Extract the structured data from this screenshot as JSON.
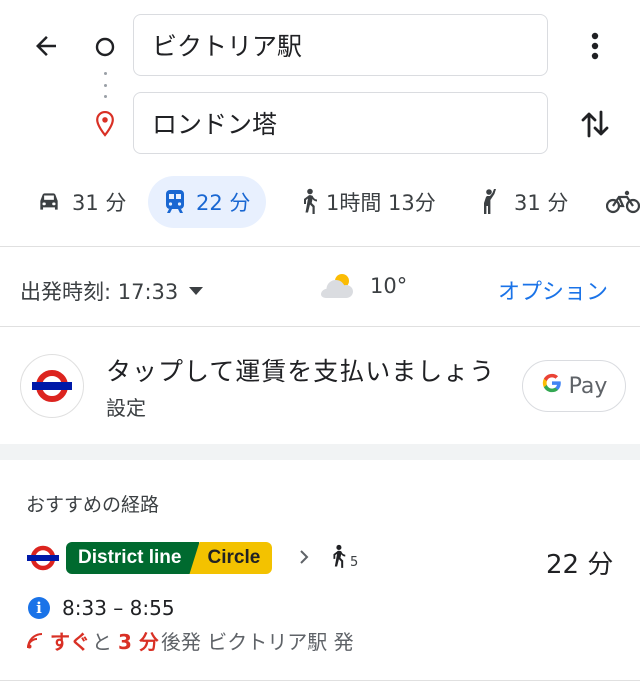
{
  "search": {
    "origin": "ビクトリア駅",
    "destination": "ロンドン塔"
  },
  "modes": [
    {
      "name": "driving",
      "icon": "car-icon",
      "label": "31 分"
    },
    {
      "name": "transit",
      "icon": "train-icon",
      "label": "22 分",
      "active": true
    },
    {
      "name": "walking",
      "icon": "walk-icon",
      "label": "1時間 13分"
    },
    {
      "name": "rideshare",
      "icon": "hail-icon",
      "label": "31 分"
    },
    {
      "name": "cycling",
      "icon": "bike-icon",
      "label": ""
    }
  ],
  "departure": {
    "label": "出発時刻: 17:33",
    "weather_temp": "10°",
    "options_label": "オプション"
  },
  "pay_banner": {
    "title": "タップして運賃を支払いましょう",
    "subtitle": "設定",
    "gpay_label": "Pay"
  },
  "routes": {
    "section_title": "おすすめの経路",
    "items": [
      {
        "lines": [
          "District line",
          "Circle"
        ],
        "walk_minutes": "5",
        "duration": "22 分",
        "time_range": "8:33 – 8:55",
        "realtime": {
          "soon": "すぐ",
          "and": "と",
          "minutes": "3 分",
          "suffix": "後発 ビクトリア駅 発"
        }
      }
    ]
  },
  "colors": {
    "accent": "#1a73e8",
    "active_bg": "#e8f0fe",
    "district": "#006a2f",
    "circle": "#f3c200",
    "alert_red": "#d93025",
    "tfl_red": "#dc241f",
    "tfl_blue": "#0019a8"
  }
}
